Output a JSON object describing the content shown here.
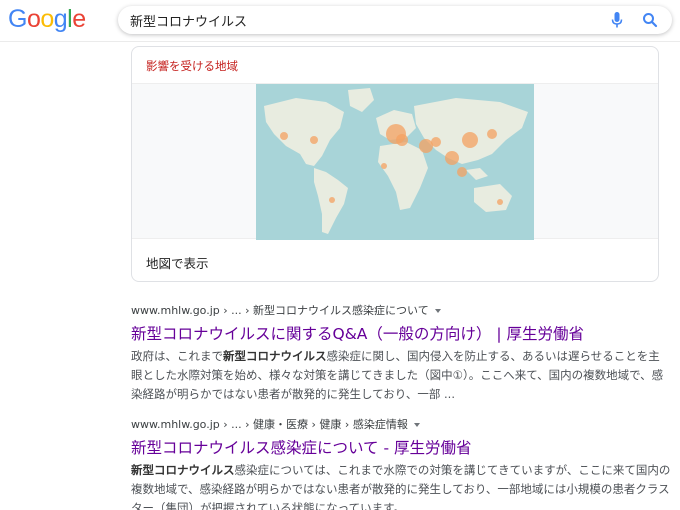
{
  "header": {
    "logo_letters": [
      {
        "char": "G",
        "color": "#4285F4"
      },
      {
        "char": "o",
        "color": "#EA4335"
      },
      {
        "char": "o",
        "color": "#FBBC05"
      },
      {
        "char": "g",
        "color": "#4285F4"
      },
      {
        "char": "l",
        "color": "#34A853"
      },
      {
        "char": "e",
        "color": "#EA4335"
      }
    ],
    "search_value": "新型コロナウイルス",
    "icons": {
      "mic": "microphone-icon",
      "search": "magnifier-icon"
    }
  },
  "map_card": {
    "title": "影響を受ける地域",
    "link": "地図で表示",
    "hotspot_color": "#f4a261"
  },
  "results": [
    {
      "url": "www.mhlw.go.jp › ... › 新型コロナウイルス感染症について",
      "title": "新型コロナウイルスに関するQ&A（一般の方向け） | 厚生労働省",
      "snippet_parts": [
        {
          "text": "政府は、これまで",
          "bold": false
        },
        {
          "text": "新型コロナウイルス",
          "bold": true
        },
        {
          "text": "感染症に関し、国内侵入を防止する、あるいは遅らせることを主眼とした水際対策を始め、様々な対策を講じてきました（図中①）。ここへ来て、国内の複数地域で、感染経路が明らかではない患者が散発的に発生しており、一部 ...",
          "bold": false
        }
      ]
    },
    {
      "url": "www.mhlw.go.jp › ... › 健康・医療 › 健康 › 感染症情報",
      "title": "新型コロナウイルス感染症について - 厚生労働省",
      "snippet_parts": [
        {
          "text": "新型コロナウイルス",
          "bold": true
        },
        {
          "text": "感染症については、これまで水際での対策を講じてきていますが、ここに来て国内の複数地域で、感染経路が明らかではない患者が散発的に発生しており、一部地域には小規模の患者クラスター（集団）が把握されている状態になっています。",
          "bold": false
        }
      ]
    }
  ],
  "colors": {
    "title_visited": "#660099",
    "map_water": "#a8d4d8",
    "map_land": "#e8ece0"
  }
}
